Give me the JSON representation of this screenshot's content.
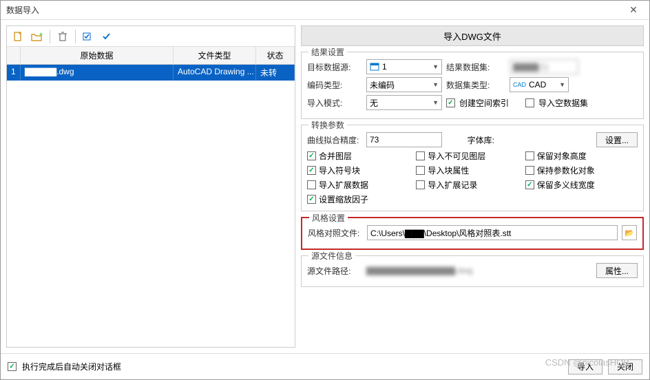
{
  "window": {
    "title": "数据导入"
  },
  "grid": {
    "headers": {
      "orig": "原始数据",
      "type": "文件类型",
      "stat": "状态"
    },
    "rows": [
      {
        "idx": "1",
        "orig": "▇▇▇▇▇.dwg",
        "type": "AutoCAD Drawing ...",
        "stat": "未转"
      }
    ]
  },
  "right": {
    "import_title": "导入DWG文件",
    "result": {
      "legend": "结果设置",
      "target_ds_label": "目标数据源:",
      "target_ds_value": "1",
      "result_ds_label": "结果数据集:",
      "result_ds_value": "▇▇▇▇(1)",
      "encoding_label": "编码类型:",
      "encoding_value": "未编码",
      "ds_type_label": "数据集类型:",
      "ds_type_value": "CAD",
      "import_mode_label": "导入模式:",
      "import_mode_value": "无",
      "create_index_label": "创建空间索引",
      "create_index_on": true,
      "import_empty_label": "导入空数据集",
      "import_empty_on": false
    },
    "convert": {
      "legend": "转换参数",
      "curve_label": "曲线拟合精度:",
      "curve_value": "73",
      "font_label": "字体库:",
      "settings_btn": "设置...",
      "cbs": [
        {
          "label": "合并图层",
          "on": true
        },
        {
          "label": "导入不可见图层",
          "on": false
        },
        {
          "label": "保留对象高度",
          "on": false
        },
        {
          "label": "导入符号块",
          "on": true
        },
        {
          "label": "导入块属性",
          "on": false
        },
        {
          "label": "保持参数化对象",
          "on": false
        },
        {
          "label": "导入扩展数据",
          "on": false
        },
        {
          "label": "导入扩展记录",
          "on": false
        },
        {
          "label": "保留多义线宽度",
          "on": true
        },
        {
          "label": "设置缩放因子",
          "on": true
        }
      ]
    },
    "style": {
      "legend": "风格设置",
      "file_label": "风格对照文件:",
      "file_value": "C:\\Users\\▇▇▇\\Desktop\\风格对照表.stt"
    },
    "src": {
      "legend": "源文件信息",
      "path_label": "源文件路径:",
      "path_value": "▇▇▇▇▇▇▇▇▇▇▇▇▇▇.dwg",
      "props_btn": "属性..."
    }
  },
  "footer": {
    "autoclose_label": "执行完成后自动关闭对话框",
    "autoclose_on": true,
    "import_btn": "导入",
    "close_btn": "关闭"
  },
  "watermark": "CSDN @nicolasHQB"
}
